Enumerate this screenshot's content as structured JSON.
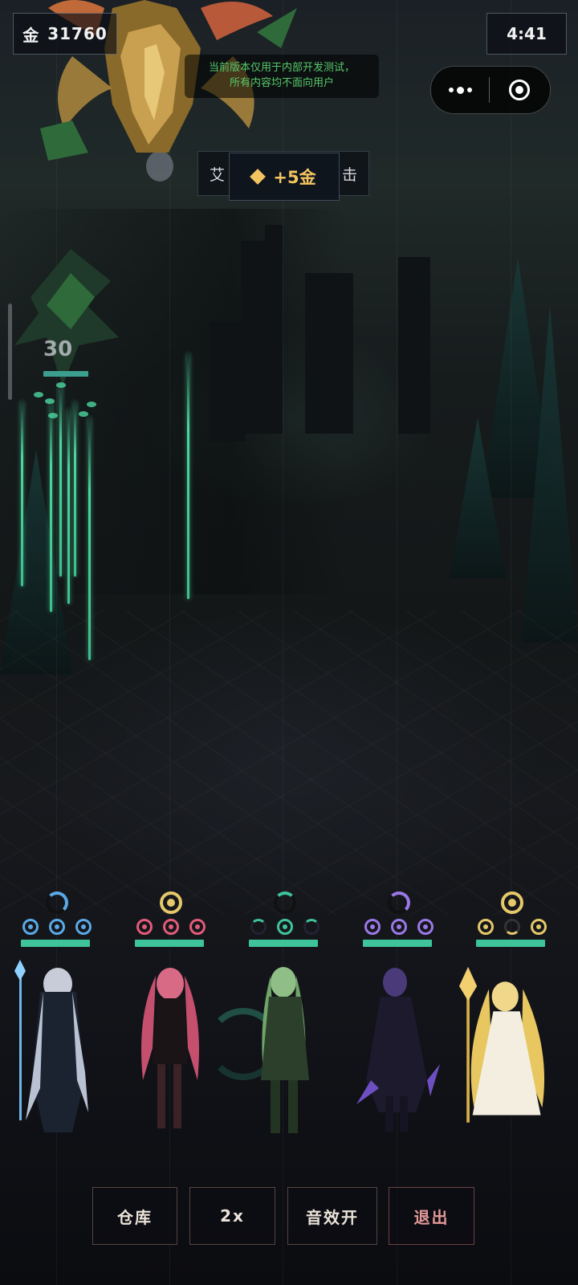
{
  "top_bar": {
    "gold_label": "金",
    "gold_value": "31760",
    "timer": "4:41"
  },
  "dev_notice": {
    "line1": "当前版本仅用于内部开发测试，",
    "line2": "所有内容均不面向用户"
  },
  "toast_back": {
    "left": "艾",
    "right": "击"
  },
  "toast": {
    "text": "+5金",
    "color": "#f2c460"
  },
  "enemy": {
    "hp_text": "30"
  },
  "heroes": [
    {
      "name": "ice",
      "color": "#5aa9e6"
    },
    {
      "name": "crimson",
      "color": "#e35a7a"
    },
    {
      "name": "verdant",
      "color": "#3fc49a"
    },
    {
      "name": "violet",
      "color": "#9b78e8"
    },
    {
      "name": "radiant",
      "color": "#e6c86a"
    }
  ],
  "buttons": {
    "warehouse": "仓库",
    "speed": "2x",
    "sound": "音效开",
    "exit": "退出"
  }
}
